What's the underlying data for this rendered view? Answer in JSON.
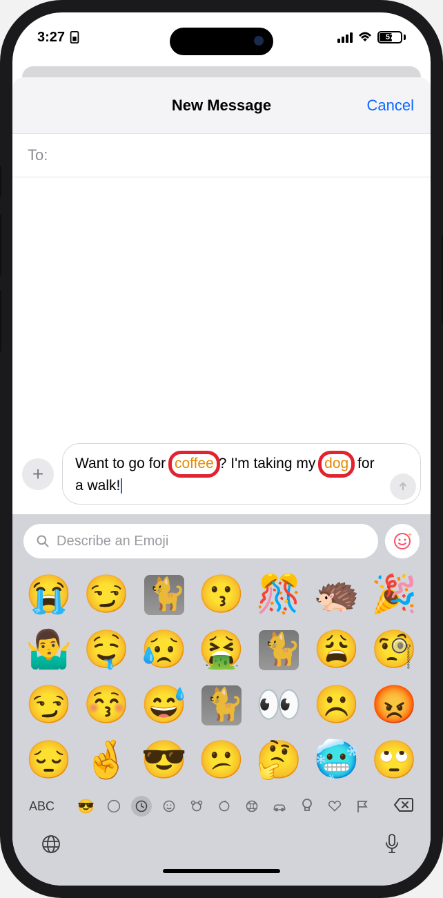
{
  "status": {
    "time": "3:27",
    "battery": "57"
  },
  "nav": {
    "title": "New Message",
    "cancel": "Cancel"
  },
  "to": {
    "label": "To:"
  },
  "compose": {
    "text_part1": "Want to go for ",
    "text_highlight1": "coffee",
    "text_part2": "? I'm taking my ",
    "text_highlight2": "dog",
    "text_part3": " for a walk!"
  },
  "emoji_search": {
    "placeholder": "Describe an Emoji"
  },
  "abc_label": "ABC",
  "emoji_rows": [
    [
      "😭",
      "😏",
      "sticker-cat",
      "😗",
      "🎊",
      "🦔",
      "🎉"
    ],
    [
      "🤷‍♂️",
      "🤤",
      "😥",
      "🤮",
      "sticker-cat",
      "😩",
      "🧐"
    ],
    [
      "😏",
      "😚",
      "😅",
      "sticker-cat",
      "👀",
      "☹️",
      "😡"
    ],
    [
      "😔",
      "🤞",
      "😎",
      "😕",
      "🤔",
      "🥶",
      "🙄"
    ]
  ],
  "categories": [
    "stickers",
    "recent",
    "clock",
    "smiley",
    "animals",
    "food",
    "activity",
    "travel",
    "objects",
    "symbols",
    "flags"
  ]
}
